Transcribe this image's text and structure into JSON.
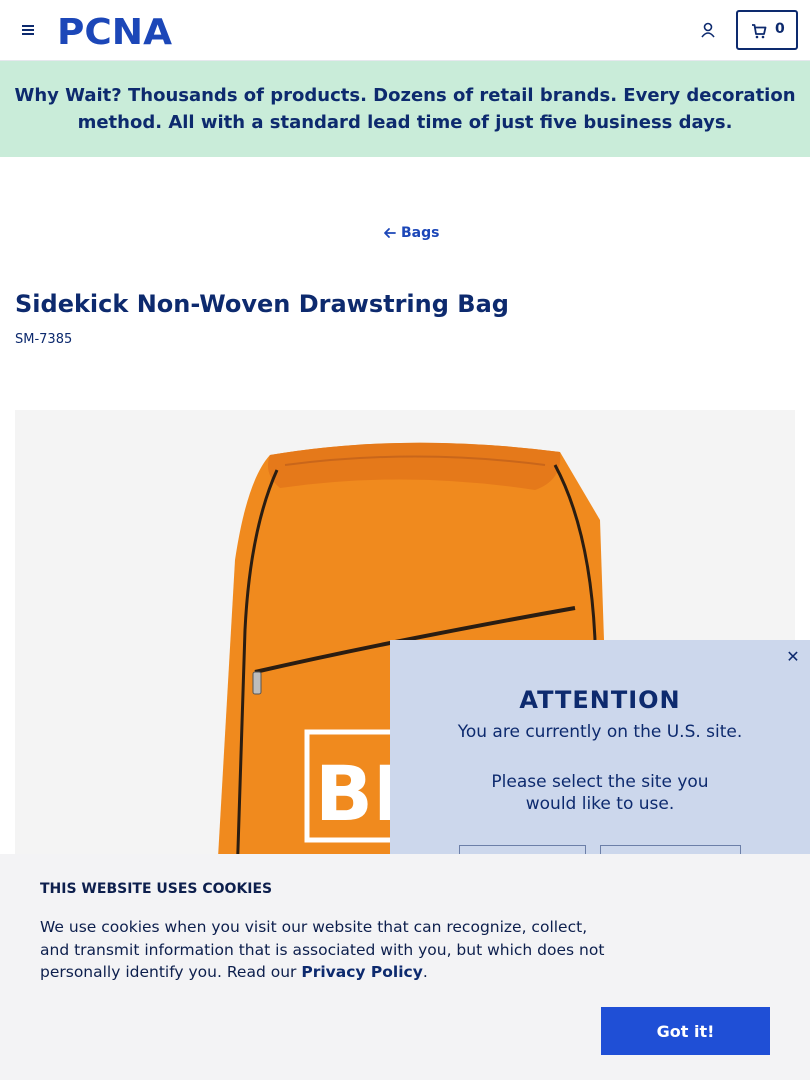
{
  "header": {
    "logo_text": "PCNA",
    "cart_count": "0",
    "icons": {
      "menu": "menu-icon",
      "account": "user-icon",
      "cart": "cart-icon"
    }
  },
  "banner": {
    "text": "Why Wait? Thousands of products. Dozens of retail brands. Every decoration method. All with a standard lead time of just five business days."
  },
  "breadcrumb": {
    "back_label": "Bags"
  },
  "product": {
    "title": "Sidekick Non-Woven Drawstring Bag",
    "sku": "SM-7385",
    "image_print_text": "BE"
  },
  "site_modal": {
    "heading": "ATTENTION",
    "line1": "You are currently on the U.S. site.",
    "line2": "Please select the site you would like to use."
  },
  "cookies": {
    "heading": "THIS WEBSITE USES COOKIES",
    "body": "We use cookies when you visit our website that can recognize, collect, and transmit information that is associated with you, but which does not personally identify you. Read our ",
    "link_label": "Privacy Policy",
    "after_link": ".",
    "button_label": "Got it!"
  },
  "colors": {
    "brand_navy": "#0d2a6e",
    "banner_bg": "#c9ecd9",
    "modal_bg": "#ccd7ec",
    "cookie_button": "#1f4fd6",
    "bag_orange": "#f08a1e"
  }
}
